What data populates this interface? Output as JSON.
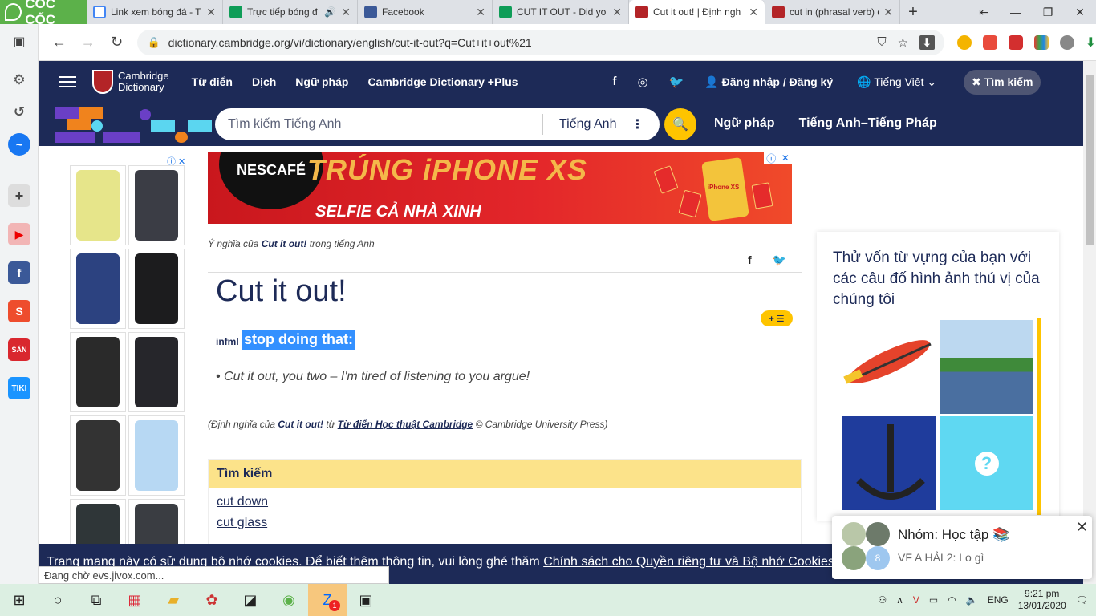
{
  "browser": {
    "brand": "CỐC CỐC",
    "tabs": [
      {
        "title": "Link xem bóng đá - T",
        "color": "#4285f4"
      },
      {
        "title": "Trực tiếp bóng đ",
        "color": "#0f9d58"
      },
      {
        "title": "Facebook",
        "color": "#3b5998"
      },
      {
        "title": "CUT IT OUT - Did you",
        "color": "#0f9d58"
      },
      {
        "title": "Cut it out! | Định ngh",
        "color": "#b32427"
      },
      {
        "title": "cut in (phrasal verb) d",
        "color": "#b32427"
      }
    ],
    "url": "dictionary.cambridge.org/vi/dictionary/english/cut-it-out?q=Cut+it+out%21",
    "status_text": "Đang chờ evs.jivox.com..."
  },
  "header": {
    "logo_line1": "Cambridge",
    "logo_line2": "Dictionary",
    "nav": [
      "Từ điển",
      "Dịch",
      "Ngữ pháp",
      "Cambridge Dictionary +Plus"
    ],
    "login": "Đăng nhập / Đăng ký",
    "language": "Tiếng Việt",
    "search_button": "Tìm kiếm"
  },
  "search": {
    "placeholder": "Tìm kiếm Tiếng Anh",
    "lang": "Tiếng Anh",
    "links": [
      "Ngữ pháp",
      "Tiếng Anh–Tiếng Pháp"
    ]
  },
  "ad_banner": {
    "brand": "NESCAFÉ",
    "headline": "TRÚNG iPHONE XS",
    "subline": "SELFIE CẢ NHÀ XINH",
    "phone_label": "iPhone XS"
  },
  "entry": {
    "meaning_prefix": "Ý nghĩa của ",
    "meaning_word": "Cut it out!",
    "meaning_suffix": " trong tiếng Anh",
    "headword": "Cut it out!",
    "grammar": "infml",
    "definition": "stop doing that:",
    "example": "Cut it out, you two – I'm tired of listening to you argue!",
    "citation_prefix": "(Định nghĩa của ",
    "citation_word": "Cut it out!",
    "citation_mid": " từ ",
    "citation_source": "Từ điển Học thuật Cambridge",
    "citation_suffix": " © Cambridge University Press)"
  },
  "search_panel": {
    "title": "Tìm kiếm",
    "links": [
      "cut down",
      "cut glass"
    ]
  },
  "quiz": {
    "text": "Thử vốn từ vựng của bạn với các câu đố hình ảnh thú vị của chúng tôi"
  },
  "cookie": {
    "text": "Trang mạng này có sử dụng bộ nhớ cookies. Để biết thêm thông tin, vui lòng ghé thăm ",
    "link": "Chính sách cho Quyền riêng tư và Bộ nhớ Cookies"
  },
  "chat": {
    "group": "Nhóm: Học tập",
    "message": "VF A HẢI 2: Lo gì",
    "badge": "8"
  },
  "taskbar": {
    "lang": "ENG",
    "time": "9:21 pm",
    "date": "13/01/2020",
    "zalo_badge": "1"
  }
}
